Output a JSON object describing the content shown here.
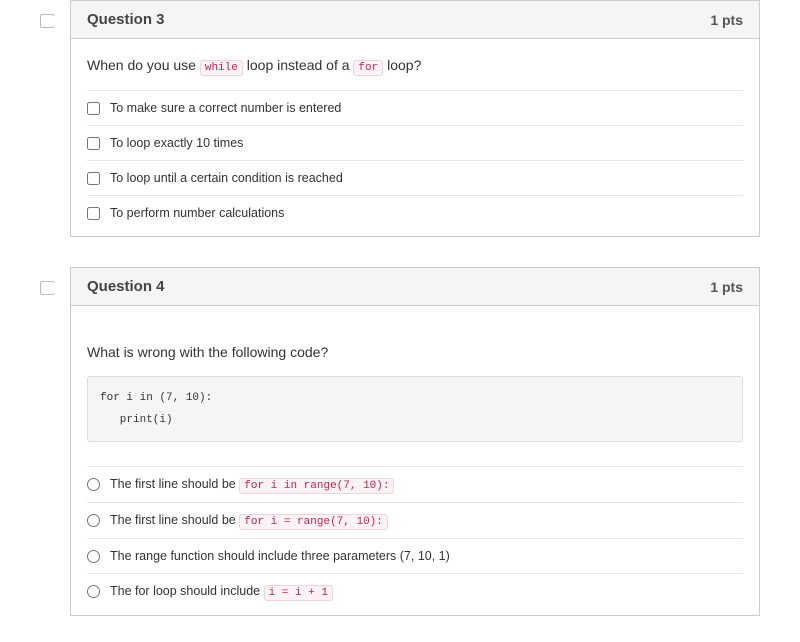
{
  "questions": [
    {
      "number": "Question 3",
      "pts": "1 pts",
      "input_type": "checkbox",
      "prompt_parts": [
        "When do you use ",
        "while",
        " loop instead of a ",
        "for",
        " loop?"
      ],
      "code_block": null,
      "options": [
        {
          "pre": "To make sure a correct number is entered",
          "code": null,
          "post": ""
        },
        {
          "pre": "To loop exactly 10 times",
          "code": null,
          "post": ""
        },
        {
          "pre": "To loop until a certain condition is reached",
          "code": null,
          "post": ""
        },
        {
          "pre": "To perform number calculations",
          "code": null,
          "post": ""
        }
      ]
    },
    {
      "number": "Question 4",
      "pts": "1 pts",
      "input_type": "radio",
      "prompt_parts": [
        "What is wrong with the following code?"
      ],
      "code_block": "for i in (7, 10):\n   print(i)",
      "options": [
        {
          "pre": "The first line should be ",
          "code": "for i in range(7, 10):",
          "post": ""
        },
        {
          "pre": "The first line should be ",
          "code": "for i = range(7, 10):",
          "post": ""
        },
        {
          "pre": "The range function should include three parameters (7, 10, 1)",
          "code": null,
          "post": ""
        },
        {
          "pre": "The for loop should include ",
          "code": "i = i + 1",
          "post": ""
        }
      ]
    }
  ]
}
